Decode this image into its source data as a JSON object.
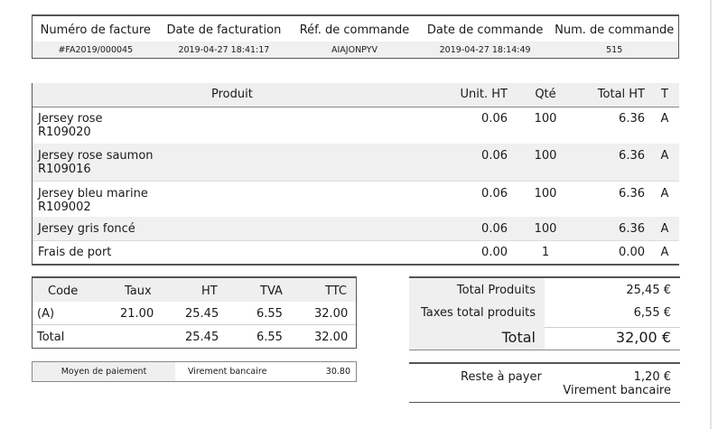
{
  "invoice_info": {
    "headers": [
      "Numéro de facture",
      "Date de facturation",
      "Réf. de commande",
      "Date de commande",
      "Num. de commande"
    ],
    "values": [
      "#FA2019/000045",
      "2019-04-27 18:41:17",
      "AIAJONPYV",
      "2019-04-27 18:14:49",
      "515"
    ]
  },
  "products": {
    "headers": {
      "product": "Produit",
      "unit": "Unit. HT",
      "qty": "Qté",
      "total": "Total HT",
      "tax": "T"
    },
    "rows": [
      {
        "name": "Jersey rose",
        "ref": "R109020",
        "unit": "0.06",
        "qty": "100",
        "total": "6.36",
        "tax": "A"
      },
      {
        "name": "Jersey rose saumon",
        "ref": "R109016",
        "unit": "0.06",
        "qty": "100",
        "total": "6.36",
        "tax": "A"
      },
      {
        "name": "Jersey bleu marine",
        "ref": "R109002",
        "unit": "0.06",
        "qty": "100",
        "total": "6.36",
        "tax": "A"
      },
      {
        "name": "Jersey gris foncé",
        "ref": "",
        "unit": "0.06",
        "qty": "100",
        "total": "6.36",
        "tax": "A"
      },
      {
        "name": "Frais de port",
        "ref": "",
        "unit": "0.00",
        "qty": "1",
        "total": "0.00",
        "tax": "A"
      }
    ]
  },
  "tax_table": {
    "headers": [
      "Code",
      "Taux",
      "HT",
      "TVA",
      "TTC"
    ],
    "rows": [
      [
        "(A)",
        "21.00",
        "25.45",
        "6.55",
        "32.00"
      ],
      [
        "Total",
        "",
        "25.45",
        "6.55",
        "32.00"
      ]
    ]
  },
  "totals": {
    "products_label": "Total Produits",
    "products_value": "25,45 €",
    "taxes_label": "Taxes total produits",
    "taxes_value": "6,55 €",
    "total_label": "Total",
    "total_value": "32,00 €"
  },
  "payment": {
    "label": "Moyen de paiement",
    "method": "Virement bancaire",
    "amount": "30.80"
  },
  "remaining": {
    "label": "Reste à payer",
    "value": "1,20 €",
    "method": "Virement bancaire"
  }
}
